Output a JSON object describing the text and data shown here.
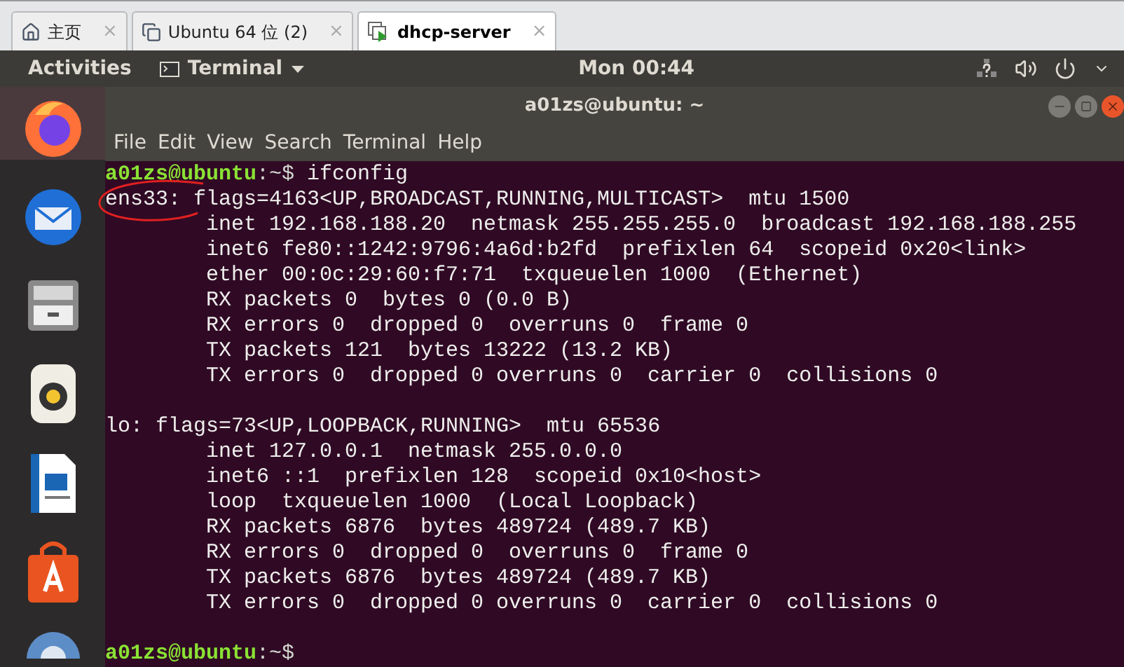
{
  "vm_tabs": [
    {
      "kind": "home",
      "label": "主页",
      "selected": false,
      "close": "×"
    },
    {
      "kind": "vm",
      "label": "Ubuntu 64 位 (2)",
      "selected": false,
      "close": "×"
    },
    {
      "kind": "vm-running",
      "label": "dhcp-server",
      "selected": true,
      "close": "×"
    }
  ],
  "top_bar": {
    "activities": "Activities",
    "app_menu": "Terminal",
    "clock": "Mon 00:44"
  },
  "dock": [
    {
      "kind": "firefox",
      "selected": true
    },
    {
      "kind": "mail",
      "selected": false
    },
    {
      "kind": "files",
      "selected": false
    },
    {
      "kind": "music",
      "selected": false
    },
    {
      "kind": "writer",
      "selected": false
    },
    {
      "kind": "software",
      "selected": false
    },
    {
      "kind": "help",
      "selected": false
    }
  ],
  "window": {
    "title": "a01zs@ubuntu: ~"
  },
  "menu": [
    "File",
    "Edit",
    "View",
    "Search",
    "Terminal",
    "Help"
  ],
  "terminal_lines": [
    {
      "kind": "prompt",
      "user_host": "a01zs@ubuntu",
      "path": ":~$",
      "command": " ifconfig"
    },
    {
      "kind": "output",
      "indented": false,
      "text": "ens33: flags=4163<UP,BROADCAST,RUNNING,MULTICAST>  mtu 1500",
      "circled": true
    },
    {
      "kind": "output",
      "indented": true,
      "text": "inet 192.168.188.20  netmask 255.255.255.0  broadcast 192.168.188.255"
    },
    {
      "kind": "output",
      "indented": true,
      "text": "inet6 fe80::1242:9796:4a6d:b2fd  prefixlen 64  scopeid 0x20<link>"
    },
    {
      "kind": "output",
      "indented": true,
      "text": "ether 00:0c:29:60:f7:71  txqueuelen 1000  (Ethernet)"
    },
    {
      "kind": "output",
      "indented": true,
      "text": "RX packets 0  bytes 0 (0.0 B)"
    },
    {
      "kind": "output",
      "indented": true,
      "text": "RX errors 0  dropped 0  overruns 0  frame 0"
    },
    {
      "kind": "output",
      "indented": true,
      "text": "TX packets 121  bytes 13222 (13.2 KB)"
    },
    {
      "kind": "output",
      "indented": true,
      "text": "TX errors 0  dropped 0 overruns 0  carrier 0  collisions 0"
    },
    {
      "kind": "blank"
    },
    {
      "kind": "output",
      "indented": false,
      "text": "lo: flags=73<UP,LOOPBACK,RUNNING>  mtu 65536"
    },
    {
      "kind": "output",
      "indented": true,
      "text": "inet 127.0.0.1  netmask 255.0.0.0"
    },
    {
      "kind": "output",
      "indented": true,
      "text": "inet6 ::1  prefixlen 128  scopeid 0x10<host>"
    },
    {
      "kind": "output",
      "indented": true,
      "text": "loop  txqueuelen 1000  (Local Loopback)"
    },
    {
      "kind": "output",
      "indented": true,
      "text": "RX packets 6876  bytes 489724 (489.7 KB)"
    },
    {
      "kind": "output",
      "indented": true,
      "text": "RX errors 0  dropped 0  overruns 0  frame 0"
    },
    {
      "kind": "output",
      "indented": true,
      "text": "TX packets 6876  bytes 489724 (489.7 KB)"
    },
    {
      "kind": "output",
      "indented": true,
      "text": "TX errors 0  dropped 0 overruns 0  carrier 0  collisions 0"
    },
    {
      "kind": "blank"
    },
    {
      "kind": "prompt",
      "user_host": "a01zs@ubuntu",
      "path": ":~$"
    }
  ]
}
